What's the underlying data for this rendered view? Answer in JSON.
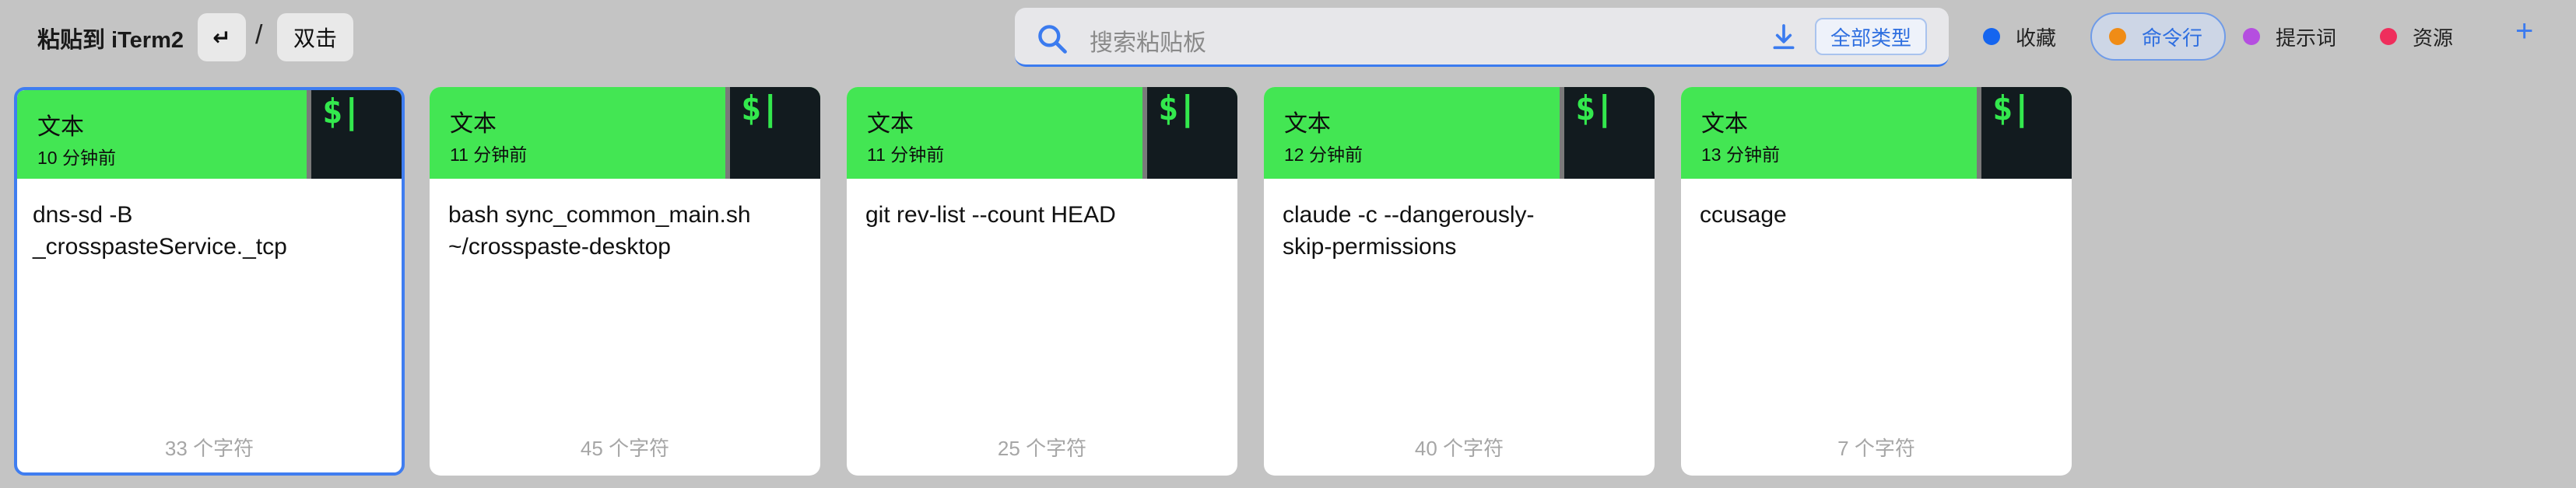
{
  "toolbar": {
    "paste_to": "粘贴到 iTerm2",
    "enter_key": "↵",
    "separator": "/",
    "double_click": "双击"
  },
  "search": {
    "placeholder": "搜索粘贴板",
    "type_filter": "全部类型"
  },
  "tags": [
    {
      "label": "收藏",
      "color": "#1565ef"
    },
    {
      "label": "命令行",
      "color": "#f08c16"
    },
    {
      "label": "提示词",
      "color": "#b54ee0"
    },
    {
      "label": "资源",
      "color": "#ef2e5c"
    }
  ],
  "add_tag": "+",
  "colors": {
    "accent": "#3b7bef",
    "card_header": "#43e653",
    "terminal_bg": "#121b1f",
    "terminal_glyph": "#33e84d"
  },
  "cards": [
    {
      "type": "文本",
      "time": "10 分钟前",
      "icon_text": "$|",
      "content": "dns-sd -B\n_crosspasteService._tcp",
      "count": "33 个字符"
    },
    {
      "type": "文本",
      "time": "11 分钟前",
      "icon_text": "$|",
      "content": "bash sync_common_main.sh\n~/crosspaste-desktop",
      "count": "45 个字符"
    },
    {
      "type": "文本",
      "time": "11 分钟前",
      "icon_text": "$|",
      "content": "git rev-list --count HEAD",
      "count": "25 个字符"
    },
    {
      "type": "文本",
      "time": "12 分钟前",
      "icon_text": "$|",
      "content": "claude -c --dangerously-\nskip-permissions",
      "count": "40 个字符"
    },
    {
      "type": "文本",
      "time": "13 分钟前",
      "icon_text": "$|",
      "content": "ccusage",
      "count": "7 个字符"
    }
  ]
}
